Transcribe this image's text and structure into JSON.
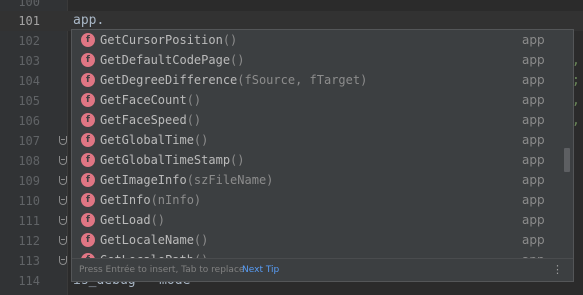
{
  "editor": {
    "lines": [
      {
        "num": "100",
        "code": ""
      },
      {
        "num": "101",
        "code": "app.",
        "current": true
      },
      {
        "num": "102",
        "code": ""
      },
      {
        "num": "103",
        "code": ""
      },
      {
        "num": "104",
        "code": ""
      },
      {
        "num": "105",
        "code": ""
      },
      {
        "num": "106",
        "code": ""
      },
      {
        "num": "107",
        "code": ""
      },
      {
        "num": "108",
        "code": ""
      },
      {
        "num": "109",
        "code": ""
      },
      {
        "num": "110",
        "code": ""
      },
      {
        "num": "111",
        "code": ""
      },
      {
        "num": "112",
        "code": ""
      },
      {
        "num": "113",
        "code": ""
      },
      {
        "num": "114",
        "code": "is_debug = mode"
      }
    ],
    "right_peek": [
      ",",
      ";",
      ",",
      ","
    ]
  },
  "completion": {
    "items": [
      {
        "name": "GetCursorPosition",
        "params": "()",
        "type": "app"
      },
      {
        "name": "GetDefaultCodePage",
        "params": "()",
        "type": "app"
      },
      {
        "name": "GetDegreeDifference",
        "params": "(fSource, fTarget)",
        "type": "app"
      },
      {
        "name": "GetFaceCount",
        "params": "()",
        "type": "app"
      },
      {
        "name": "GetFaceSpeed",
        "params": "()",
        "type": "app"
      },
      {
        "name": "GetGlobalTime",
        "params": "()",
        "type": "app"
      },
      {
        "name": "GetGlobalTimeStamp",
        "params": "()",
        "type": "app"
      },
      {
        "name": "GetImageInfo",
        "params": "(szFileName)",
        "type": "app"
      },
      {
        "name": "GetInfo",
        "params": "(nInfo)",
        "type": "app"
      },
      {
        "name": "GetLoad",
        "params": "()",
        "type": "app"
      },
      {
        "name": "GetLocaleName",
        "params": "()",
        "type": "app"
      },
      {
        "name": "GetLocalePath",
        "params": "()",
        "type": "app"
      }
    ],
    "badge_letter": "f",
    "hint_text": "Press Entrée to insert, Tab to replace",
    "hint_link": "Next Tip",
    "menu_glyph": "⋮"
  },
  "colors": {
    "background": "#2b2b2b",
    "popup": "#3c3f41",
    "function_badge": "#e07684",
    "link": "#589df6"
  }
}
